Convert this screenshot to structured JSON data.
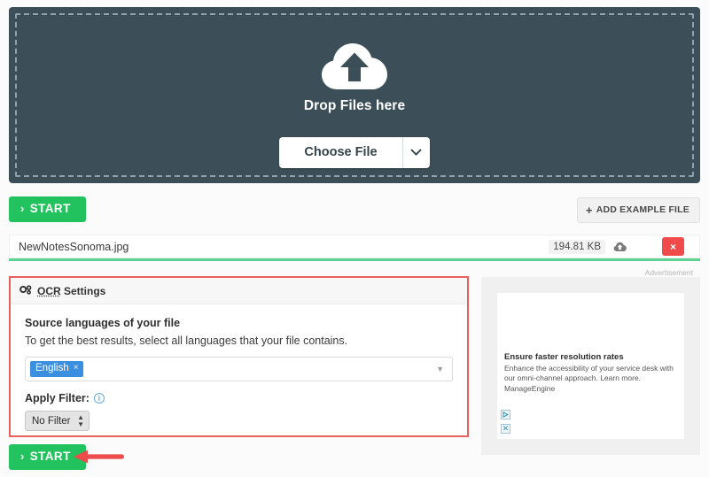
{
  "dropzone": {
    "icon": "cloud-upload-icon",
    "drop_text": "Drop Files here",
    "choose_file_label": "Choose File",
    "caret_icon": "chevron-down-icon"
  },
  "toolbar": {
    "start_label": "START",
    "start_chevron": "›",
    "add_example_label": "ADD EXAMPLE FILE",
    "plus_icon": "+"
  },
  "file": {
    "name": "NewNotesSonoma.jpg",
    "size": "194.81 KB",
    "status_icon": "cloud-upload-icon",
    "remove_icon": "×",
    "progress_color": "#5cd392"
  },
  "ocr_settings": {
    "gear_icon": "gears-icon",
    "title_abbr": "OCR",
    "title_rest": " Settings",
    "languages_label": "Source languages of your file",
    "languages_help": "To get the best results, select all languages that your file contains.",
    "selected_language": "English",
    "tag_remove_icon": "×",
    "select_caret": "▼",
    "filter_label": "Apply Filter:",
    "filter_info_icon": "i",
    "filter_value": "No Filter",
    "panel_border_color": "#e8615f"
  },
  "bottom": {
    "start_label": "START",
    "start_chevron": "›",
    "arrow_color": "#ee4b4b",
    "arrow_name": "red-pointer-arrow"
  },
  "advertisement": {
    "label": "Advertisement",
    "title": "Ensure faster resolution rates",
    "body": "Enhance the accessibility of your service desk with our omni-channel approach. Learn more. ManageEngine",
    "adchoices_icon": "adchoices-triangle-icon",
    "close_icon": "✕"
  },
  "colors": {
    "dropzone_bg": "#3c4f58",
    "start_green": "#22c35e",
    "remove_red": "#f04a4a",
    "tag_blue": "#3b8fe0"
  }
}
